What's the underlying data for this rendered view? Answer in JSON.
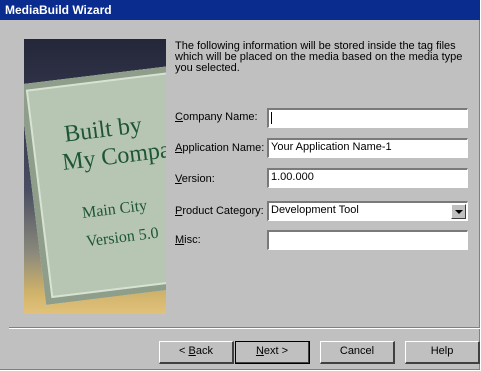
{
  "window": {
    "title": "MediaBuild Wizard"
  },
  "art": {
    "line1": "Built by",
    "line2": "My Compar",
    "line3": "Main City",
    "line4": "Version 5.0"
  },
  "intro": "The following information will be stored inside the tag files which will be placed on the media based on the media type you selected.",
  "form": {
    "company_label_key": "C",
    "company_label_rest": "ompany Name:",
    "company_value": "",
    "appname_label_key": "A",
    "appname_label_rest": "pplication Name:",
    "appname_value": "Your Application Name-1",
    "version_label_key": "V",
    "version_label_rest": "ersion:",
    "version_value": "1.00.000",
    "category_label_key": "P",
    "category_label_rest": "roduct Category:",
    "category_value": "Development Tool",
    "misc_label_key": "M",
    "misc_label_rest": "isc:",
    "misc_value": ""
  },
  "buttons": {
    "back_prefix": "< ",
    "back_key": "B",
    "back_rest": "ack",
    "next_key": "N",
    "next_rest": "ext >",
    "cancel": "Cancel",
    "help": "Help"
  }
}
